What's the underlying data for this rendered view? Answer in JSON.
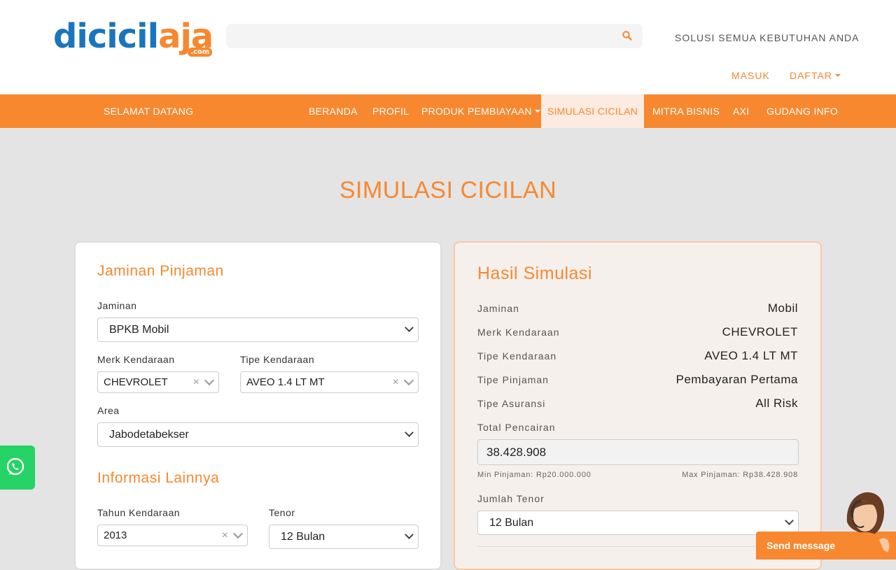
{
  "header": {
    "logo": {
      "part1": "dicicil",
      "part2": "aja",
      "suffix": ".com"
    },
    "search": {
      "placeholder": ""
    },
    "tagline": "SOLUSI SEMUA KEBUTUHAN ANDA",
    "masuk": "MASUK",
    "daftar": "DAFTAR"
  },
  "nav": {
    "welcome": "SELAMAT DATANG",
    "items": [
      "BERANDA",
      "PROFIL",
      "PRODUK PEMBIAYAAN",
      "SIMULASI CICILAN",
      "MITRA BISNIS",
      "AXI",
      "GUDANG INFO"
    ],
    "active": "SIMULASI CICILAN"
  },
  "page_title": "SIMULASI CICILAN",
  "form": {
    "section1": "Jaminan Pinjaman",
    "jaminan": {
      "label": "Jaminan",
      "value": "BPKB Mobil"
    },
    "merk": {
      "label": "Merk Kendaraan",
      "value": "CHEVROLET"
    },
    "tipe": {
      "label": "Tipe Kendaraan",
      "value": "AVEO 1.4 LT MT"
    },
    "area": {
      "label": "Area",
      "value": "Jabodetabekser"
    },
    "section2": "Informasi Lainnya",
    "tahun": {
      "label": "Tahun Kendaraan",
      "value": "2013"
    },
    "tenor": {
      "label": "Tenor",
      "value": "12 Bulan"
    }
  },
  "result": {
    "title": "Hasil Simulasi",
    "rows": [
      {
        "label": "Jaminan",
        "value": "Mobil"
      },
      {
        "label": "Merk Kendaraan",
        "value": "CHEVROLET"
      },
      {
        "label": "Tipe Kendaraan",
        "value": "AVEO 1.4 LT MT"
      },
      {
        "label": "Tipe Pinjaman",
        "value": "Pembayaran Pertama"
      },
      {
        "label": "Tipe Asuransi",
        "value": "All Risk"
      }
    ],
    "total_label": "Total Pencairan",
    "total_value": "38.428.908",
    "min": "Min Pinjaman: Rp20.000.000",
    "max": "Max Pinjaman: Rp38.428.908",
    "tenor_label": "Jumlah Tenor",
    "tenor_value": "12 Bulan"
  },
  "chat": {
    "send": "Send message"
  },
  "colors": {
    "orange": "#f7882f",
    "blue": "#1b75bc",
    "whatsapp": "#25d366"
  },
  "icons": [
    "search-icon",
    "caret-down-icon",
    "chevron-down-icon",
    "clear-icon",
    "whatsapp-icon"
  ]
}
